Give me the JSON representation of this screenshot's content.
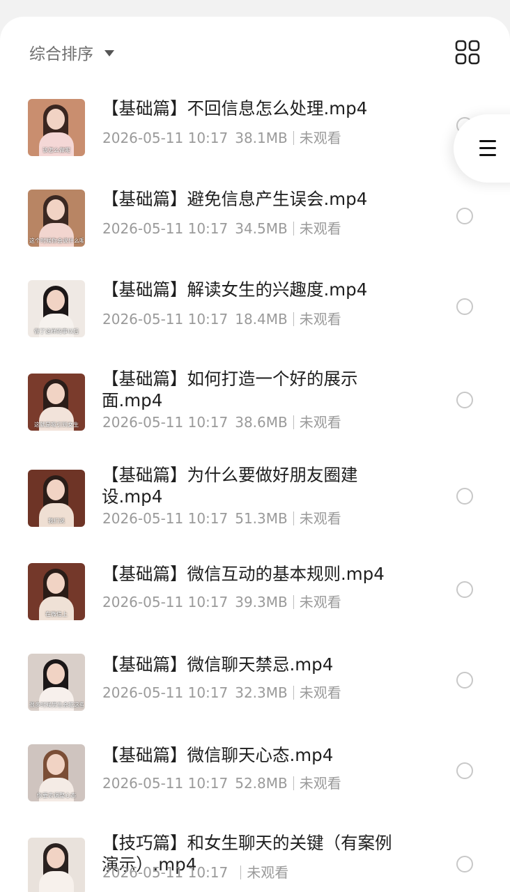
{
  "toolbar": {
    "sort_label": "综合排序"
  },
  "files": [
    {
      "title": "【基础篇】不回信息怎么处理.mp4",
      "date": "2026-05-11 10:17",
      "size": "38.1MB",
      "status": "未观看",
      "caption": "该怎么做呢",
      "colors": [
        "#c98e6f",
        "#f4d7d6",
        "#3a2620"
      ]
    },
    {
      "title": "【基础篇】避免信息产生误会.mp4",
      "date": "2026-05-11 10:17",
      "size": "34.5MB",
      "status": "未观看",
      "caption": "这个时候你会说什么呢",
      "colors": [
        "#b88564",
        "#f2d5cf",
        "#3a2822"
      ]
    },
    {
      "title": "【基础篇】解读女生的兴趣度.mp4",
      "date": "2026-05-11 10:17",
      "size": "18.4MB",
      "status": "未观看",
      "caption": "做了这样的事以后",
      "colors": [
        "#efe9e4",
        "#f6f2ee",
        "#1c1718"
      ]
    },
    {
      "title": "【基础篇】如何打造一个好的展示面.mp4",
      "date": "2026-05-11 10:17",
      "size": "38.6MB",
      "status": "未观看",
      "caption": "这就是吸引到女生",
      "colors": [
        "#7a3b2c",
        "#f2e3da",
        "#2b1d19"
      ]
    },
    {
      "title": "【基础篇】为什么要做好朋友圈建设.mp4",
      "date": "2026-05-11 10:17",
      "size": "51.3MB",
      "status": "未观看",
      "caption": "我们说",
      "colors": [
        "#6e3426",
        "#efdfd3",
        "#2a1d18"
      ]
    },
    {
      "title": "【基础篇】微信互动的基本规则.mp4",
      "date": "2026-05-11 10:17",
      "size": "39.3MB",
      "status": "未观看",
      "caption": "在微信上",
      "colors": [
        "#74382a",
        "#efe1d6",
        "#2a1c17"
      ]
    },
    {
      "title": "【基础篇】微信聊天禁忌.mp4",
      "date": "2026-05-11 10:17",
      "size": "32.3MB",
      "status": "未观看",
      "caption": "很多时候男生会犯这些错误",
      "colors": [
        "#d9cfc9",
        "#f7f0ec",
        "#1b1718"
      ]
    },
    {
      "title": "【基础篇】微信聊天心态.mp4",
      "date": "2026-05-11 10:17",
      "size": "52.8MB",
      "status": "未观看",
      "caption": "你要去调整心态",
      "colors": [
        "#cfc4bf",
        "#f4ebe5",
        "#7b4e36"
      ]
    },
    {
      "title": "【技巧篇】和女生聊天的关键（有案例演示）.mp4",
      "date": "2026-05-11 10:17",
      "size": "",
      "status": "未观看",
      "caption": "",
      "colors": [
        "#e9e2dc",
        "#f7f1ec",
        "#2a2220"
      ]
    }
  ]
}
